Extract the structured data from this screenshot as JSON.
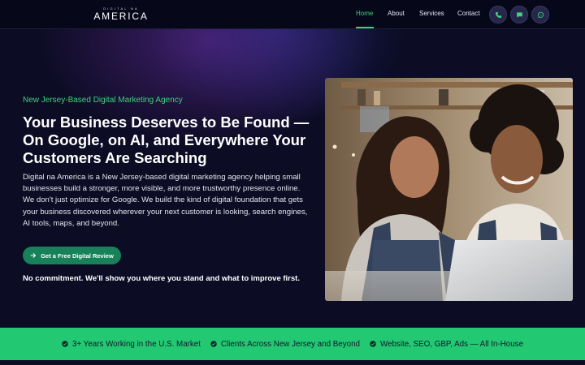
{
  "brand": {
    "logo_small": "DIGITAL NA",
    "logo_big": "AMERICA"
  },
  "nav": {
    "links": [
      {
        "label": "Home",
        "active": true
      },
      {
        "label": "About",
        "active": false
      },
      {
        "label": "Services",
        "active": false
      },
      {
        "label": "Contact",
        "active": false
      }
    ],
    "icons": [
      "phone-icon",
      "chat-icon",
      "whatsapp-icon"
    ],
    "accent_color": "#3fd27c"
  },
  "hero": {
    "eyebrow": "New Jersey-Based Digital Marketing Agency",
    "headline": "Your Business Deserves to Be Found — On Google, on AI, and Everywhere Your Customers Are Searching",
    "lede": "Digital na America is a New Jersey-based digital marketing agency helping small businesses build a stronger, more visible, and more trustworthy presence online. We don't just optimize for Google. We build the kind of digital foundation that gets your business discovered wherever your next customer is looking, search engines, AI tools, maps, and beyond.",
    "cta_label": "Get a Free Digital Review",
    "cta_icon": "arrow-right-icon",
    "note": "No commitment. We'll show you where you stand and what to improve first.",
    "button_color": "#17815a"
  },
  "trust": {
    "items": [
      "3+ Years Working in the U.S. Market",
      "Clients Across New Jersey and Beyond",
      "Website, SEO, GBP, Ads — All In-House"
    ],
    "icon": "check-circle-icon",
    "bar_color": "#23c872"
  }
}
